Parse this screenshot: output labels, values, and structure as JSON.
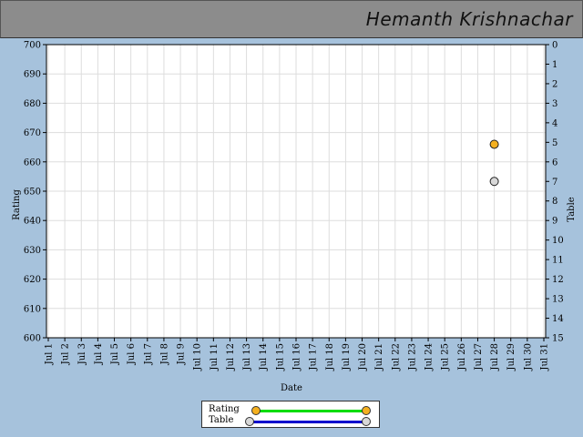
{
  "header": {
    "title": "Hemanth Krishnachar"
  },
  "colors": {
    "rating_marker": "#f4b020",
    "table_marker": "#d8d8d8",
    "rating_line": "#00dd00",
    "table_line": "#0000cc",
    "plot_bg": "#ffffff",
    "grid": "#dddddd",
    "page_bg": "#a6c2dc"
  },
  "chart_data": {
    "type": "scatter",
    "xlabel": "Date",
    "ylabel_left": "Rating",
    "ylabel_right": "Table",
    "categories": [
      "Jul 1",
      "Jul 2",
      "Jul 3",
      "Jul 4",
      "Jul 5",
      "Jul 6",
      "Jul 7",
      "Jul 8",
      "Jul 9",
      "Jul 10",
      "Jul 11",
      "Jul 12",
      "Jul 13",
      "Jul 14",
      "Jul 15",
      "Jul 16",
      "Jul 17",
      "Jul 18",
      "Jul 19",
      "Jul 20",
      "Jul 21",
      "Jul 22",
      "Jul 23",
      "Jul 24",
      "Jul 25",
      "Jul 26",
      "Jul 27",
      "Jul 28",
      "Jul 29",
      "Jul 30",
      "Jul 31"
    ],
    "ylim_left": [
      600,
      700
    ],
    "yticks_left": [
      "600",
      "610",
      "620",
      "630",
      "640",
      "650",
      "660",
      "670",
      "680",
      "690",
      "700"
    ],
    "ylim_right": [
      0,
      15
    ],
    "right_axis_inverted": true,
    "yticks_right": [
      "0",
      "1",
      "2",
      "3",
      "4",
      "5",
      "6",
      "7",
      "8",
      "9",
      "10",
      "11",
      "12",
      "13",
      "14",
      "15"
    ],
    "grid": true,
    "legend_position": "bottom-center",
    "series": [
      {
        "name": "Rating",
        "axis": "left",
        "points": [
          {
            "x": "Jul 28",
            "y": 666
          }
        ]
      },
      {
        "name": "Table",
        "axis": "right",
        "points": [
          {
            "x": "Jul 28",
            "y": 7
          }
        ]
      }
    ]
  }
}
